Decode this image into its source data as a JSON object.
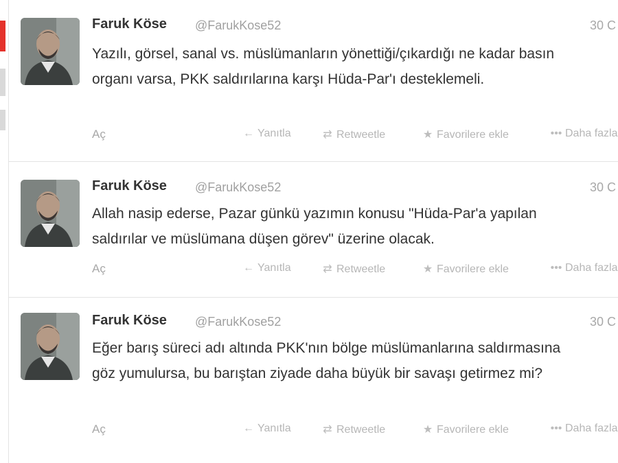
{
  "tweets": [
    {
      "name": "Faruk Köse",
      "handle": "@FarukKose52",
      "time": "30 C",
      "text": "Yazılı, görsel, sanal vs. müslümanların yönettiği/çıkardığı ne kadar basın organı varsa, PKK saldırılarına karşı Hüda-Par'ı desteklemeli.",
      "expand": "Aç"
    },
    {
      "name": "Faruk Köse",
      "handle": "@FarukKose52",
      "time": "30 C",
      "text": "Allah nasip ederse, Pazar günkü yazımın konusu \"Hüda-Par'a yapılan saldırılar ve müslümana düşen görev\" üzerine olacak.",
      "expand": "Aç"
    },
    {
      "name": "Faruk Köse",
      "handle": "@FarukKose52",
      "time": "30 C",
      "text": "Eğer barış süreci adı altında PKK'nın bölge müslümanlarına saldırmasına göz yumulursa, bu barıştan ziyade daha büyük bir savaşı getirmez mi?",
      "expand": "Aç"
    }
  ],
  "actions": {
    "reply": "Yanıtla",
    "retweet": "Retweetle",
    "favorite": "Favorilere ekle",
    "more": "Daha fazla"
  },
  "icons": {
    "reply": "reply-arrow-icon",
    "retweet": "retweet-icon",
    "favorite": "star-icon",
    "more": "ellipsis-icon"
  },
  "colors": {
    "name": "#333333",
    "muted": "#a8a8a8",
    "accent_strip": "#e4322b"
  }
}
